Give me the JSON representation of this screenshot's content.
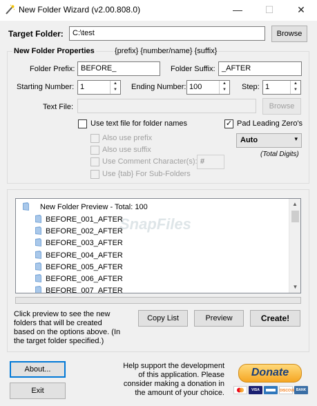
{
  "window": {
    "title": "New Folder Wizard   (v2.00.808.0)",
    "controls": {
      "minimize": "—",
      "maximize": "☐",
      "close": "✕"
    }
  },
  "target_folder": {
    "label": "Target Folder:",
    "value": "C:\\test",
    "browse_label": "Browse"
  },
  "properties": {
    "heading": "New Folder Properties",
    "placeholders_hint": "{prefix} {number/name} {suffix}",
    "prefix_label": "Folder Prefix:",
    "prefix_value": "BEFORE_",
    "suffix_label": "Folder Suffix:",
    "suffix_value": "_AFTER",
    "start_label": "Starting Number:",
    "start_value": "1",
    "end_label": "Ending Number:",
    "end_value": "100",
    "step_label": "Step:",
    "step_value": "1",
    "textfile_label": "Text File:",
    "textfile_value": "",
    "textfile_browse_label": "Browse",
    "use_textfile_label": "Use text file for folder names",
    "use_textfile_checked": false,
    "pad_zero_label": "Pad Leading Zero's",
    "pad_zero_checked": true,
    "digits_value": "Auto",
    "digits_caption": "(Total Digits)",
    "also_prefix_label": "Also use prefix",
    "also_suffix_label": "Also use suffix",
    "comment_char_label": "Use Comment Character(s):",
    "comment_char_value": "#",
    "tab_subfolders_label": "Use {tab} For Sub-Folders"
  },
  "preview": {
    "root_label": "New Folder Preview - Total: 100",
    "items": [
      "BEFORE_001_AFTER",
      "BEFORE_002_AFTER",
      "BEFORE_003_AFTER",
      "BEFORE_004_AFTER",
      "BEFORE_005_AFTER",
      "BEFORE_006_AFTER",
      "BEFORE_007_AFTER"
    ],
    "watermark": "SnapFiles",
    "progress": 0,
    "hint": "Click preview to see the new folders that will be created based on the options above. (In the target folder specified.)",
    "copy_list_label": "Copy List",
    "preview_label": "Preview",
    "create_label": "Create!"
  },
  "footer": {
    "about_label": "About...",
    "exit_label": "Exit",
    "support_text": "Help support the development of this application. Please consider making a donation in the amount of your choice.",
    "donate_label": "Donate",
    "cards": [
      "VISA",
      "",
      "DISCOVER",
      "BANK"
    ]
  },
  "colors": {
    "folder_icon": "#7aa7d8",
    "accent": "#0078d7",
    "donate_text": "#1a3f7a"
  }
}
